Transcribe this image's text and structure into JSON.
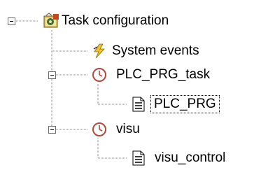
{
  "tree": {
    "root": {
      "label": "Task configuration",
      "expanded": true,
      "icon": "task-configuration-icon"
    },
    "children": [
      {
        "label": "System events",
        "icon": "lightning-icon"
      },
      {
        "label": "PLC_PRG_task",
        "icon": "clock-icon",
        "expanded": true,
        "children": [
          {
            "label": "PLC_PRG",
            "icon": "document-icon",
            "selected": true
          }
        ]
      },
      {
        "label": "visu",
        "icon": "clock-icon",
        "expanded": true,
        "children": [
          {
            "label": "visu_control",
            "icon": "document-icon"
          }
        ]
      }
    ]
  }
}
